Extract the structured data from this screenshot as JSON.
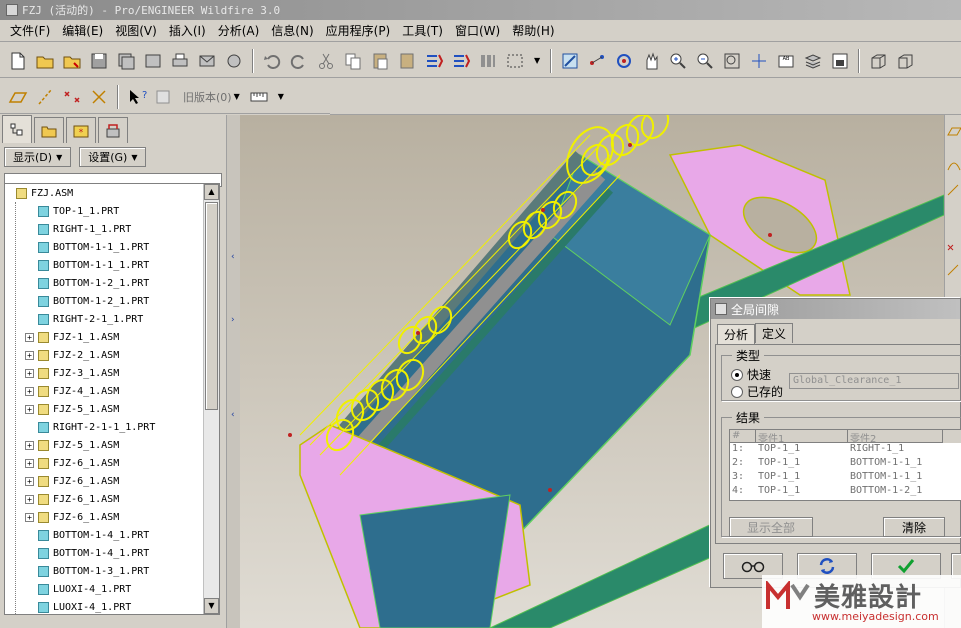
{
  "window": {
    "title": "FZJ (活动的) - Pro/ENGINEER Wildfire 3.0"
  },
  "menu": [
    "文件(F)",
    "编辑(E)",
    "视图(V)",
    "插入(I)",
    "分析(A)",
    "信息(N)",
    "应用程序(P)",
    "工具(T)",
    "窗口(W)",
    "帮助(H)"
  ],
  "toolbar2": {
    "version_dropdown": "旧版本(0)"
  },
  "navigator": {
    "show_button": "显示(D)",
    "settings_button": "设置(G)",
    "tree": [
      {
        "label": "FZJ.ASM",
        "type": "asm",
        "root": true,
        "expandable": false
      },
      {
        "label": "TOP-1_1.PRT",
        "type": "prt",
        "expandable": false
      },
      {
        "label": "RIGHT-1_1.PRT",
        "type": "prt",
        "expandable": false
      },
      {
        "label": "BOTTOM-1-1_1.PRT",
        "type": "prt",
        "expandable": false
      },
      {
        "label": "BOTTOM-1-1_1.PRT",
        "type": "prt",
        "expandable": false
      },
      {
        "label": "BOTTOM-1-2_1.PRT",
        "type": "prt",
        "expandable": false
      },
      {
        "label": "BOTTOM-1-2_1.PRT",
        "type": "prt",
        "expandable": false
      },
      {
        "label": "RIGHT-2-1_1.PRT",
        "type": "prt",
        "expandable": false
      },
      {
        "label": "FJZ-1_1.ASM",
        "type": "asm",
        "expandable": true
      },
      {
        "label": "FJZ-2_1.ASM",
        "type": "asm",
        "expandable": true
      },
      {
        "label": "FJZ-3_1.ASM",
        "type": "asm",
        "expandable": true
      },
      {
        "label": "FJZ-4_1.ASM",
        "type": "asm",
        "expandable": true
      },
      {
        "label": "FJZ-5_1.ASM",
        "type": "asm",
        "expandable": true
      },
      {
        "label": "RIGHT-2-1-1_1.PRT",
        "type": "prt",
        "expandable": false
      },
      {
        "label": "FJZ-5_1.ASM",
        "type": "asm",
        "expandable": true
      },
      {
        "label": "FJZ-6_1.ASM",
        "type": "asm",
        "expandable": true
      },
      {
        "label": "FJZ-6_1.ASM",
        "type": "asm",
        "expandable": true
      },
      {
        "label": "FJZ-6_1.ASM",
        "type": "asm",
        "expandable": true
      },
      {
        "label": "FJZ-6_1.ASM",
        "type": "asm",
        "expandable": true
      },
      {
        "label": "BOTTOM-1-4_1.PRT",
        "type": "prt",
        "expandable": false
      },
      {
        "label": "BOTTOM-1-4_1.PRT",
        "type": "prt",
        "expandable": false
      },
      {
        "label": "BOTTOM-1-3_1.PRT",
        "type": "prt",
        "expandable": false
      },
      {
        "label": "LUOXI-4_1.PRT",
        "type": "prt",
        "expandable": false
      },
      {
        "label": "LUOXI-4_1.PRT",
        "type": "prt",
        "expandable": false
      }
    ]
  },
  "dialog": {
    "title": "全局间隙",
    "tabs": [
      "分析",
      "定义"
    ],
    "type_group": "类型",
    "option_quick": "快速",
    "option_saved": "已存的",
    "saved_value": "Global_Clearance_1",
    "results_group": "结果",
    "columns": [
      "#",
      "零件1",
      "零件2"
    ],
    "rows": [
      {
        "n": "1:",
        "p1": "TOP-1_1",
        "p2": "RIGHT-1_1"
      },
      {
        "n": "2:",
        "p1": "TOP-1_1",
        "p2": "BOTTOM-1-1_1"
      },
      {
        "n": "3:",
        "p1": "TOP-1_1",
        "p2": "BOTTOM-1-1_1"
      },
      {
        "n": "4:",
        "p1": "TOP-1_1",
        "p2": "BOTTOM-1-2_1"
      }
    ],
    "show_all_button": "显示全部",
    "clear_button": "清除"
  },
  "watermark": {
    "brand": "美雅設計",
    "url": "www.meiyadesign.com"
  },
  "colors": {
    "model_teal": "#2e6e8e",
    "model_green": "#2a8a6a",
    "model_pink": "#e8a8e8",
    "highlight_yellow": "#f0f000",
    "background_top": "#b8b0a0",
    "background_bottom": "#e0dcd4"
  }
}
